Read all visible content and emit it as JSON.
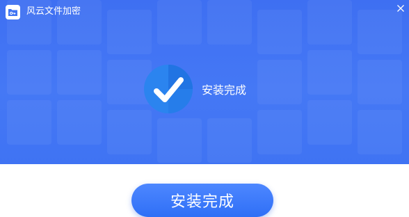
{
  "window": {
    "title": "风云文件加密",
    "app_icon": "app-logo-icon",
    "close_icon": "close-icon"
  },
  "status": {
    "icon": "check-circle-icon",
    "message": "安装完成"
  },
  "actions": {
    "finish_label": "安装完成"
  },
  "colors": {
    "hero_background": "#3f73f3",
    "button_background": "#3b7bff",
    "check_circle": "#2f8cf3",
    "text_light": "#ffffff"
  }
}
